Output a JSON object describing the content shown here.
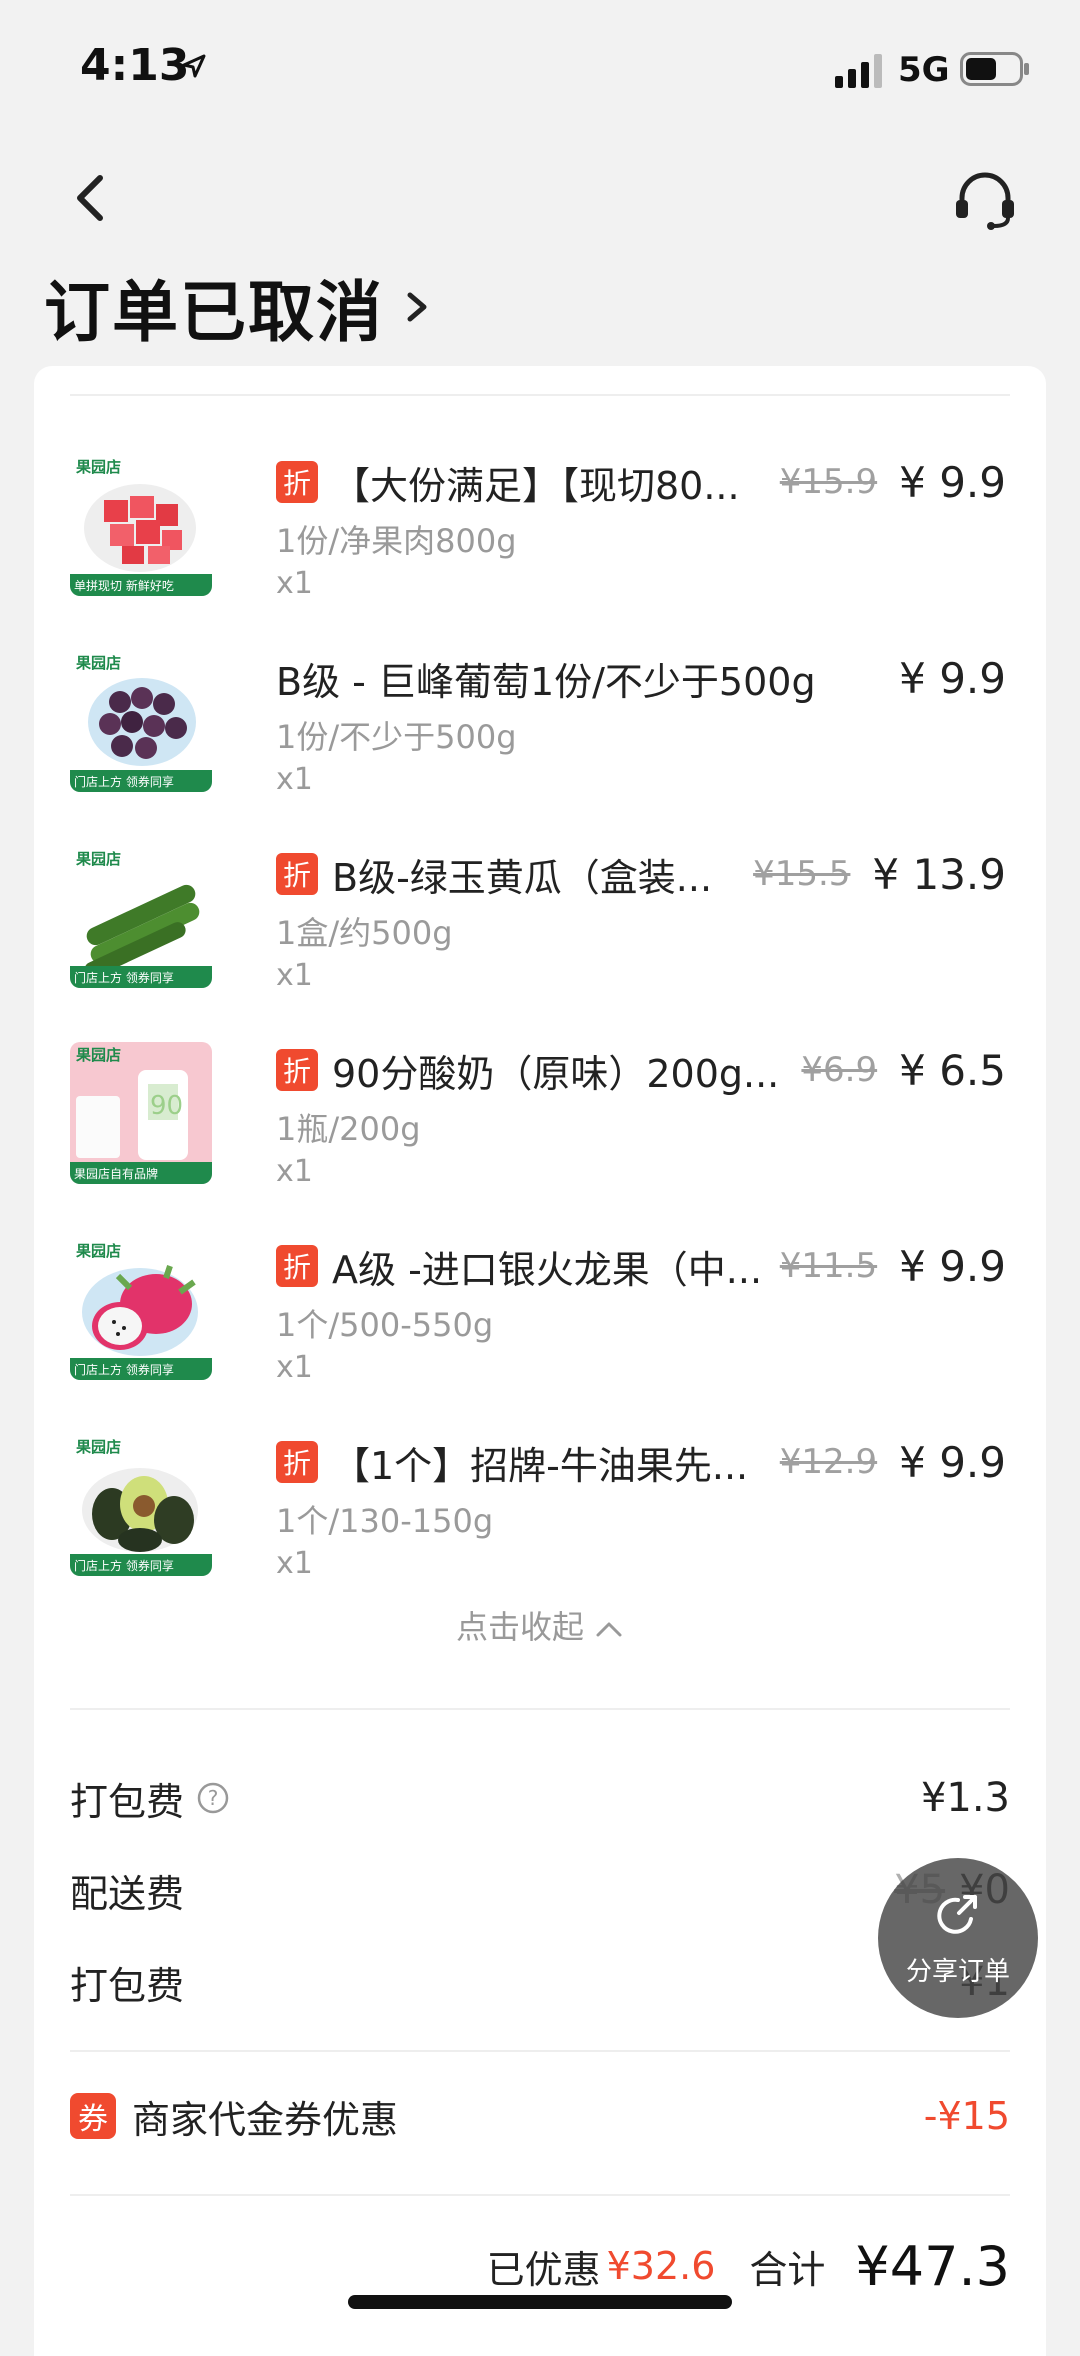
{
  "status_bar": {
    "time": "4:13",
    "network": "5G",
    "location_icon": "location-arrow-icon",
    "signal_icon": "signal-icon",
    "battery_icon": "battery-icon"
  },
  "nav": {
    "back_icon": "chevron-left-icon",
    "support_icon": "headset-icon"
  },
  "order": {
    "status": "订单已取消",
    "status_chevron_icon": "chevron-right-icon"
  },
  "items": [
    {
      "discount_badge": "折",
      "name": "【大份满足】【现切80...",
      "original_price": "¥15.9",
      "price": "¥ 9.9",
      "spec": "1份/净果肉800g",
      "quantity": "x1",
      "thumb_store": "果园店",
      "thumb_caption": "单拼现切 新鲜好吃"
    },
    {
      "discount_badge": "",
      "name": "B级 - 巨峰葡萄1份/不少于500g",
      "original_price": "",
      "price": "¥ 9.9",
      "spec": "1份/不少于500g",
      "quantity": "x1",
      "thumb_store": "果园店",
      "thumb_caption": "门店上方 领券同享"
    },
    {
      "discount_badge": "折",
      "name": "B级-绿玉黄瓜（盒装...",
      "original_price": "¥15.5",
      "price": "¥ 13.9",
      "spec": "1盒/约500g",
      "quantity": "x1",
      "thumb_store": "果园店",
      "thumb_caption": "门店上方 领券同享"
    },
    {
      "discount_badge": "折",
      "name": "90分酸奶（原味）200g...",
      "original_price": "¥6.9",
      "price": "¥ 6.5",
      "spec": "1瓶/200g",
      "quantity": "x1",
      "thumb_store": "果园店",
      "thumb_caption": "果园店自有品牌"
    },
    {
      "discount_badge": "折",
      "name": "A级 -进口银火龙果（中...",
      "original_price": "¥11.5",
      "price": "¥ 9.9",
      "spec": "1个/500-550g",
      "quantity": "x1",
      "thumb_store": "果园店",
      "thumb_caption": "门店上方 领券同享"
    },
    {
      "discount_badge": "折",
      "name": "【1个】招牌-牛油果先...",
      "original_price": "¥12.9",
      "price": "¥ 9.9",
      "spec": "1个/130-150g",
      "quantity": "x1",
      "thumb_store": "果园店",
      "thumb_caption": "门店上方 领券同享"
    }
  ],
  "collapse": {
    "label": "点击收起",
    "icon": "chevron-up-icon"
  },
  "fees": [
    {
      "label": "打包费",
      "original": "",
      "value": "¥1.3",
      "help_icon": "question-circle-icon"
    },
    {
      "label": "配送费",
      "original": "¥5",
      "value": "¥0"
    },
    {
      "label": "打包费",
      "original": "",
      "value": "¥1"
    }
  ],
  "coupon": {
    "badge": "券",
    "label": "商家代金券优惠",
    "value": "-¥15"
  },
  "summary": {
    "discount_label": "已优惠",
    "discount_amount": "¥32.6",
    "total_label": "合计",
    "total_value": "¥47.3"
  },
  "share": {
    "label": "分享订单",
    "icon": "share-icon"
  },
  "colors": {
    "accent_red": "#f04a2f",
    "brand_green": "#1f8a4c",
    "background": "#f2f2f2"
  }
}
